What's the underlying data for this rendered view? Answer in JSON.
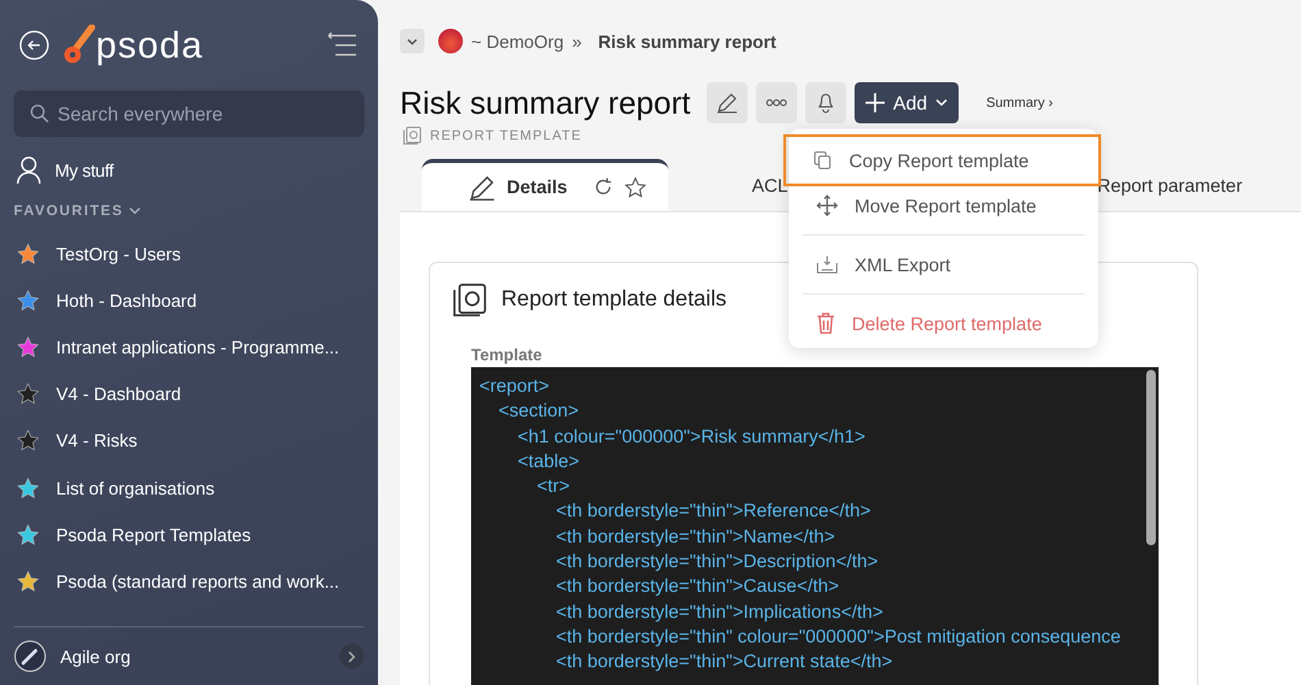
{
  "sidebar": {
    "logo": "psoda",
    "search": {
      "placeholder": "Search everywhere"
    },
    "my_stuff": "My stuff",
    "favourites_heading": "FAVOURITES",
    "favourites": [
      {
        "label": "TestOrg - Users",
        "color": "#f5883a"
      },
      {
        "label": "Hoth - Dashboard",
        "color": "#3b8fe8"
      },
      {
        "label": "Intranet applications - Programme...",
        "color": "#e83ad8"
      },
      {
        "label": "V4 - Dashboard",
        "color": "#222222"
      },
      {
        "label": "V4 - Risks",
        "color": "#222222"
      },
      {
        "label": "List of organisations",
        "color": "#3ac8e0"
      },
      {
        "label": "Psoda Report Templates",
        "color": "#3ac8e0"
      },
      {
        "label": "Psoda (standard reports and work...",
        "color": "#e8b83a"
      }
    ],
    "org": "Agile org"
  },
  "breadcrumb": {
    "org": "~ DemoOrg",
    "separator": "»",
    "current": "Risk summary report"
  },
  "header": {
    "title": "Risk summary report",
    "add_button": "Add",
    "summary_link": "Summary ›",
    "subtitle": "REPORT TEMPLATE"
  },
  "tabs": [
    {
      "label": "Details",
      "selected": true
    },
    {
      "label": "ACL",
      "selected": false
    },
    {
      "label": "Report parameter",
      "selected": false
    }
  ],
  "menu": {
    "items": [
      {
        "label": "Copy Report template",
        "kind": "normal",
        "highlighted": true
      },
      {
        "label": "Move Report template",
        "kind": "normal",
        "highlighted": false
      },
      {
        "label": "XML Export",
        "kind": "normal",
        "highlighted": false
      },
      {
        "label": "Delete Report template",
        "kind": "danger",
        "highlighted": false
      }
    ]
  },
  "card": {
    "title": "Report template details",
    "field_label": "Template",
    "code": [
      {
        "text": "<report>",
        "children": [
          {
            "text": "<section>",
            "children": [
              {
                "text": "<h1 colour=\"000000\">Risk summary</h1>"
              },
              {
                "text": "<table>",
                "children": [
                  {
                    "text": "<tr>",
                    "children": [
                      {
                        "text": "<th borderstyle=\"thin\">Reference</th>"
                      },
                      {
                        "text": "<th borderstyle=\"thin\">Name</th>"
                      },
                      {
                        "text": "<th borderstyle=\"thin\">Description</th>"
                      },
                      {
                        "text": "<th borderstyle=\"thin\">Cause</th>"
                      },
                      {
                        "text": "<th borderstyle=\"thin\">Implications</th>"
                      },
                      {
                        "text": "<th borderstyle=\"thin\" colour=\"000000\">Post mitigation consequence"
                      },
                      {
                        "text": "<th borderstyle=\"thin\">Current state</th>"
                      }
                    ]
                  }
                ]
              }
            ]
          }
        ]
      }
    ]
  }
}
